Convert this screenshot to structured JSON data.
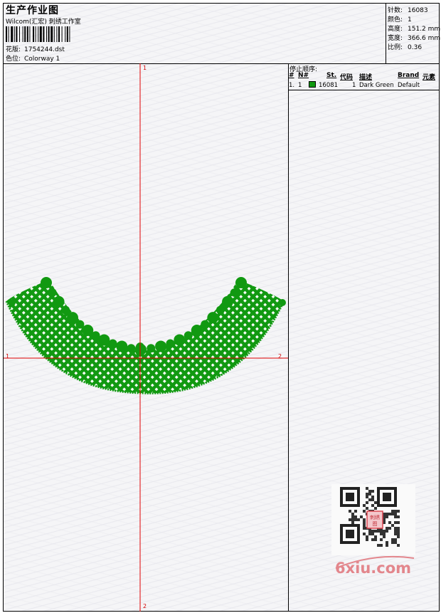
{
  "header": {
    "title": "生产作业图",
    "company": "Wilcom(汇宏) 刺绣工作室",
    "design_label": "花版:",
    "design_value": "1754244.dst",
    "colorway_label": "色位:",
    "colorway_value": "Colorway 1"
  },
  "stats": [
    {
      "label": "针数:",
      "value": "16083"
    },
    {
      "label": "颜色:",
      "value": "1"
    },
    {
      "label": "高度:",
      "value": "151.2 mm"
    },
    {
      "label": "宽度:",
      "value": "366.6 mm"
    },
    {
      "label": "比例:",
      "value": "0.36"
    }
  ],
  "design_area": {
    "axis_labels": {
      "top": "1",
      "left": "1",
      "right": "2",
      "bottom": "2"
    },
    "crosshair_color": "#e00000",
    "embroidery_color": "#119911"
  },
  "stop_sequence": {
    "title": "停止顺序:",
    "columns": [
      "#",
      "N#",
      "St.",
      "代码",
      "描述",
      "Brand",
      "元素"
    ],
    "rows": [
      {
        "index": "1.",
        "needle": "1",
        "color": "#119911",
        "stitches_value": "16081",
        "code": "1",
        "description": "Dark Green",
        "brand": "Default",
        "element": ""
      }
    ]
  },
  "watermark": {
    "text": "6xiu.com",
    "stamp_top": "刺绣",
    "stamp_bottom": "图"
  }
}
